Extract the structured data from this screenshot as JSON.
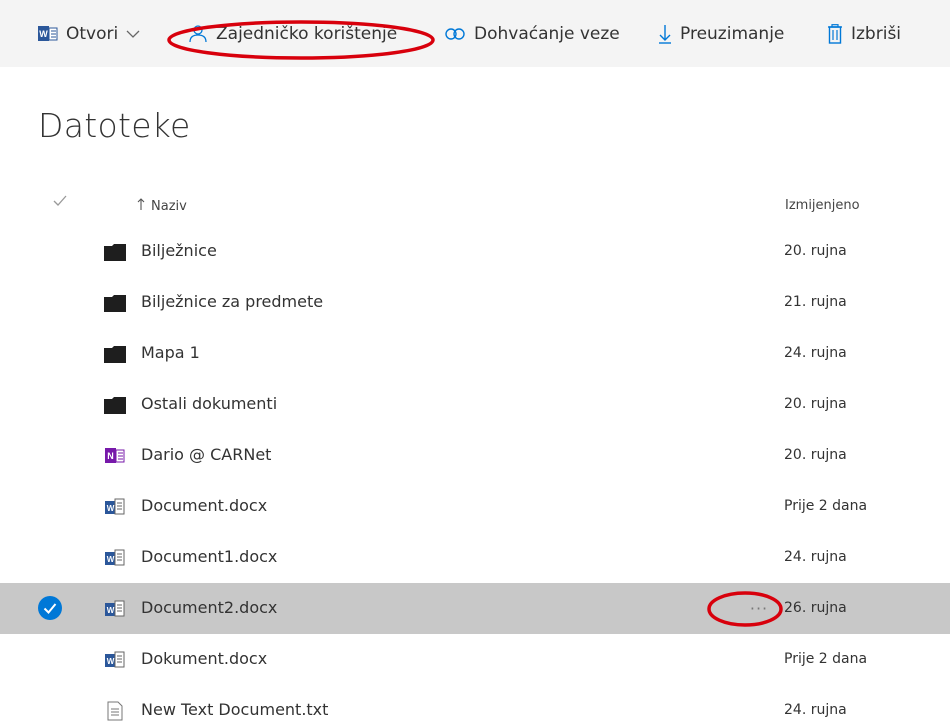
{
  "toolbar": {
    "open_label": "Otvori",
    "share_label": "Zajedničko korištenje",
    "get_link_label": "Dohvaćanje veze",
    "download_label": "Preuzimanje",
    "delete_label": "Izbriši"
  },
  "page": {
    "title": "Datoteke"
  },
  "list": {
    "columns": {
      "name": "Naziv",
      "modified": "Izmijenjeno"
    },
    "rows": [
      {
        "name": "Bilježnice",
        "modified": "20. rujna",
        "icon": "folder-icon"
      },
      {
        "name": "Bilježnice za predmete",
        "modified": "21. rujna",
        "icon": "folder-icon"
      },
      {
        "name": "Mapa 1",
        "modified": "24. rujna",
        "icon": "folder-icon"
      },
      {
        "name": "Ostali dokumenti",
        "modified": "20. rujna",
        "icon": "folder-icon"
      },
      {
        "name": "Dario @ CARNet",
        "modified": "20. rujna",
        "icon": "onenote-icon"
      },
      {
        "name": "Document.docx",
        "modified": "Prije 2 dana",
        "icon": "word-doc-icon"
      },
      {
        "name": "Document1.docx",
        "modified": "24. rujna",
        "icon": "word-doc-icon"
      },
      {
        "name": "Document2.docx",
        "modified": "26. rujna",
        "icon": "word-doc-icon",
        "selected": true,
        "more_label": "···"
      },
      {
        "name": "Dokument.docx",
        "modified": "Prije 2 dana",
        "icon": "word-doc-icon"
      },
      {
        "name": "New Text Document.txt",
        "modified": "24. rujna",
        "icon": "text-file-icon"
      }
    ]
  },
  "colors": {
    "toolbar_bg": "#f4f4f4",
    "accent_blue": "#0078d7",
    "selected_row_bg": "#c8c8c8",
    "annotation_red": "#d8000c",
    "word_blue": "#2b579a",
    "onenote_purple": "#7719aa"
  }
}
